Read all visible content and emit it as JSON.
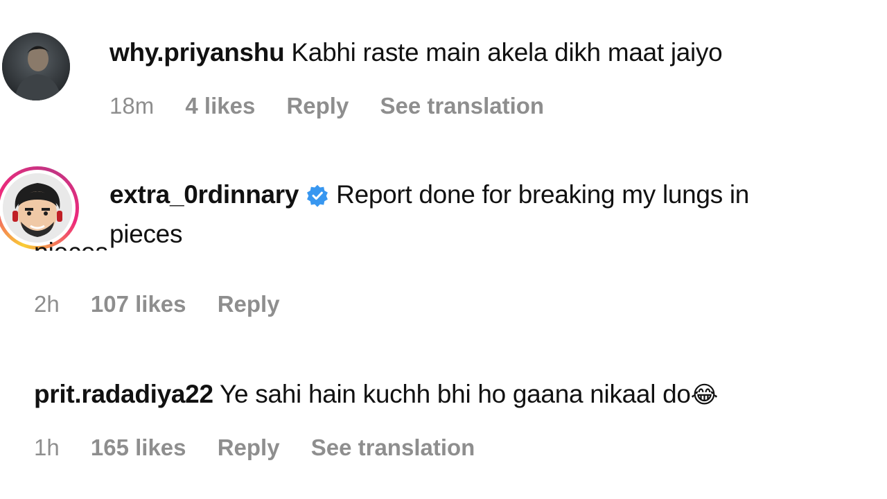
{
  "comments": [
    {
      "username": "why.priyanshu",
      "text": "Kabhi raste main akela dikh maat jaiyo",
      "time": "18m",
      "likes": "4 likes",
      "reply_label": "Reply",
      "translate_label": "See translation",
      "avatar_icon": "user-photo-avatar"
    },
    {
      "username": "extra_0rdinnary",
      "verified": true,
      "text_line1": "Report done for breaking my lungs in",
      "text_line2": "pieces",
      "text_line2_ghost": "pieces",
      "time": "2h",
      "likes": "107 likes",
      "reply_label": "Reply",
      "avatar_icon": "cartoon-avatar-story-ring"
    },
    {
      "username": "prit.radadiya22",
      "text": "Ye sahi hain kuchh bhi ho gaana nikaal do",
      "emoji": "😂",
      "time": "1h",
      "likes": "165 likes",
      "reply_label": "Reply",
      "translate_label": "See translation"
    }
  ],
  "colors": {
    "text": "#111111",
    "meta": "#8e8e8e",
    "verified": "#3897f0",
    "story_ring_start": "#f9ce34",
    "story_ring_mid": "#ee2a7b",
    "story_ring_end": "#6228d7"
  }
}
